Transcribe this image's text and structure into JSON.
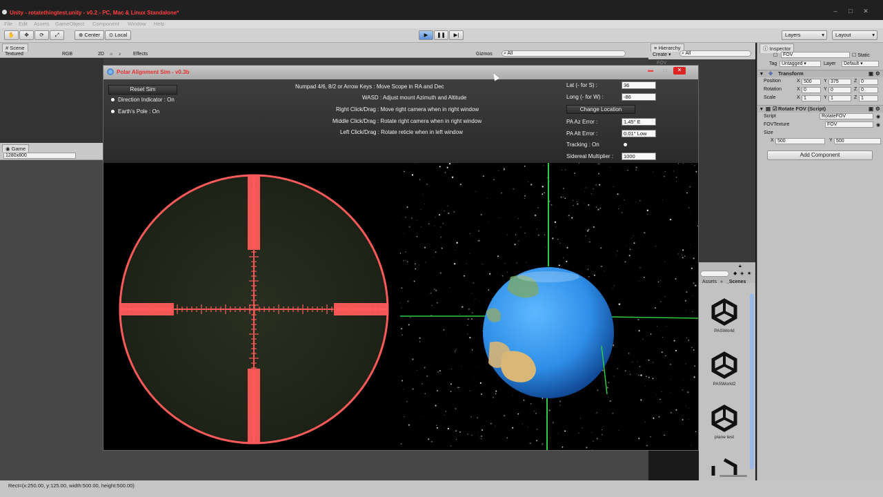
{
  "window": {
    "title": "Unity - rotatethingtest.unity - v0.2 - PC, Mac & Linux Standalone*"
  },
  "menu": [
    "File",
    "Edit",
    "Assets",
    "GameObject",
    "Component",
    "Window",
    "Help"
  ],
  "toolbar": {
    "center": "Center",
    "local": "Local",
    "layers": "Layers",
    "layout": "Layout"
  },
  "scene": {
    "tab": "Scene",
    "shading": "Textured",
    "rgb": "RGB",
    "mode2d": "2D",
    "effects": "Effects",
    "gizmos": "Gizmos",
    "search": "All"
  },
  "game": {
    "tab": "Game",
    "resolution": "1280x800"
  },
  "hierarchy": {
    "tab": "Hierarchy",
    "create": "Create",
    "search": "All",
    "item": "FOV"
  },
  "project": {
    "breadcrumb_root": "Assets",
    "breadcrumb_sep": "»",
    "breadcrumb_folder": "_Scenes",
    "assets": [
      "PASWorld",
      "PASWorld2",
      "plane test"
    ]
  },
  "inspector": {
    "tab": "Inspector",
    "object_name": "FOV",
    "static": "Static",
    "tag_label": "Tag",
    "tag_value": "Untagged",
    "layer_label": "Layer",
    "layer_value": "Default",
    "transform": {
      "header": "Transform",
      "position": "Position",
      "rotation": "Rotation",
      "scale": "Scale",
      "pos": [
        "500",
        "375",
        "0"
      ],
      "rot": [
        "0",
        "0",
        "0"
      ],
      "scl": [
        "1",
        "1",
        "1"
      ]
    },
    "script": {
      "header": "Rotate FOV (Script)",
      "script_label": "Script",
      "script_value": "RotateFOV",
      "tex_label": "FOVTexture",
      "tex_value": "FOV",
      "size_label": "Size",
      "x_label": "X",
      "x_value": "500",
      "y_label": "Y",
      "y_value": "500"
    },
    "add_component": "Add Component"
  },
  "status": "Rect=(x:250.00, y:125.00, width:500.00, height:500.00)",
  "sim": {
    "title": "Polar Alignment Sim - v0.3b",
    "reset": "Reset Sim",
    "direction_indicator": "Direction Indicator : On",
    "earths_pole": "Earth's Pole : On",
    "instructions": [
      "Numpad 4/6, 8/2 or Arrow Keys : Move Scope in RA and Dec",
      "WASD : Adjust mount Azimuth and Altitude",
      "Right Click/Drag : Move right camera when in right window",
      "Middle Click/Drag : Rotate right camera when in right window",
      "Left Click/Drag : Rotate reticle when in left window"
    ],
    "lat_label": "Lat (- for S) :",
    "lat_value": "36",
    "long_label": "Long (- for W) :",
    "long_value": "-86",
    "change_location": "Change Location",
    "pa_az_label": "PA Az Error :",
    "pa_az_value": "1.45° E",
    "pa_alt_label": "PA Alt Error :",
    "pa_alt_value": "0.01° Low",
    "tracking": "Tracking : On",
    "sidereal_label": "Sidereal Multiplier :",
    "sidereal_value": "1000"
  },
  "colors": {
    "reticle": "#ff5a5a",
    "crosshair_green": "#2ecc40",
    "earth_ocean": "#2f8fe8",
    "title_red": "#ff4040"
  }
}
